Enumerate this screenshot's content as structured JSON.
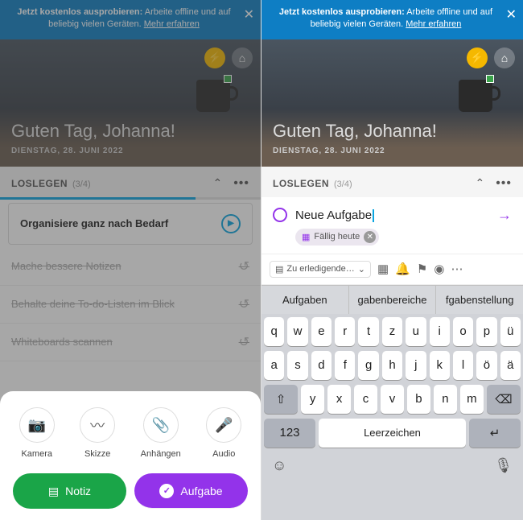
{
  "banner": {
    "bold": "Jetzt kostenlos ausprobieren:",
    "text": " Arbeite offline und auf beliebig vielen Geräten. ",
    "link": "Mehr erfahren"
  },
  "hero": {
    "greeting": "Guten Tag, Johanna!",
    "date": "DIENSTAG, 28. JUNI 2022"
  },
  "section": {
    "title": "LOSLEGEN",
    "count": "(3/4)"
  },
  "tasks": {
    "active": "Organisiere ganz nach Bedarf",
    "done": [
      "Mache bessere Notizen",
      "Behalte deine To-do-Listen im Blick",
      "Whiteboards scannen"
    ]
  },
  "sheet": {
    "items": [
      {
        "label": "Kamera",
        "icon": "camera"
      },
      {
        "label": "Skizze",
        "icon": "sketch"
      },
      {
        "label": "Anhängen",
        "icon": "attach"
      },
      {
        "label": "Audio",
        "icon": "mic"
      }
    ],
    "noteBtn": "Notiz",
    "taskBtn": "Aufgabe"
  },
  "newtask": {
    "placeholder": "Neue Aufgabe",
    "chip": "Fällig heute",
    "notebook": "Zu erledigende…"
  },
  "suggestions": [
    "Aufgaben",
    "gabenbereiche",
    "fgabenstellung"
  ],
  "keys": {
    "r1": [
      "q",
      "w",
      "e",
      "r",
      "t",
      "z",
      "u",
      "i",
      "o",
      "p",
      "ü"
    ],
    "r2": [
      "a",
      "s",
      "d",
      "f",
      "g",
      "h",
      "j",
      "k",
      "l",
      "ö",
      "ä"
    ],
    "r3": [
      "y",
      "x",
      "c",
      "v",
      "b",
      "n",
      "m"
    ],
    "num": "123",
    "space": "Leerzeichen"
  }
}
